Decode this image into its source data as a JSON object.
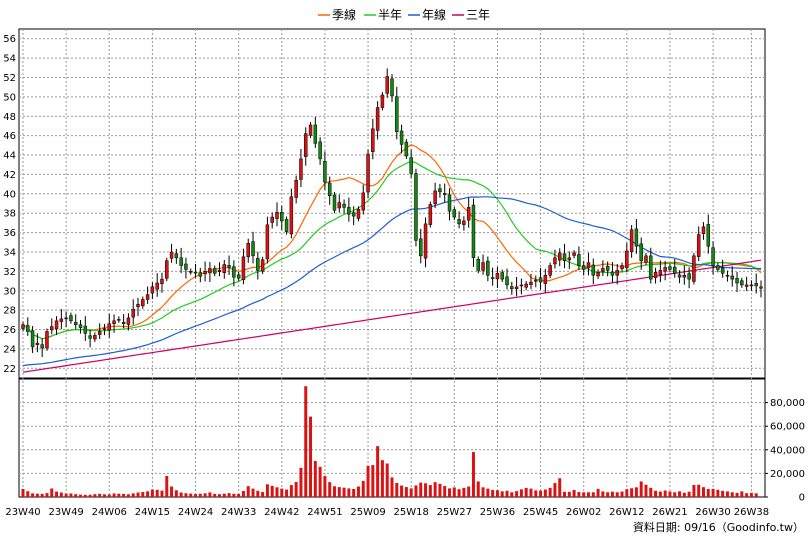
{
  "chart_data": {
    "type": "candlestick",
    "legend": [
      {
        "name": "季線",
        "color": "#ff6600"
      },
      {
        "name": "半年",
        "color": "#22cc22"
      },
      {
        "name": "年線",
        "color": "#1f5fd1"
      },
      {
        "name": "三年",
        "color": "#cc0066"
      }
    ],
    "price_axis": {
      "min": 21,
      "max": 57,
      "ticks": [
        22,
        24,
        26,
        28,
        30,
        32,
        34,
        36,
        38,
        40,
        42,
        44,
        46,
        48,
        50,
        52,
        54,
        56
      ]
    },
    "volume_axis": {
      "min": 0,
      "max": 100000,
      "ticks": [
        0,
        20000,
        40000,
        60000,
        80000
      ],
      "tick_labels": [
        "0",
        "20,000",
        "40,000",
        "60,000",
        "80,000"
      ]
    },
    "x_labels": [
      {
        "label": "23W40",
        "i": 0
      },
      {
        "label": "23W49",
        "i": 9
      },
      {
        "label": "24W06",
        "i": 18
      },
      {
        "label": "24W15",
        "i": 27
      },
      {
        "label": "24W24",
        "i": 36
      },
      {
        "label": "24W33",
        "i": 45
      },
      {
        "label": "24W42",
        "i": 54
      },
      {
        "label": "24W51",
        "i": 63
      },
      {
        "label": "25W09",
        "i": 72
      },
      {
        "label": "25W18",
        "i": 81
      },
      {
        "label": "25W27",
        "i": 90
      },
      {
        "label": "25W36",
        "i": 99
      },
      {
        "label": "25W45",
        "i": 108
      },
      {
        "label": "26W02",
        "i": 117
      },
      {
        "label": "26W12",
        "i": 126
      },
      {
        "label": "26W21",
        "i": 135
      },
      {
        "label": "26W30",
        "i": 144
      },
      {
        "label": "26W38",
        "i": 152
      }
    ],
    "closes": [
      26.5,
      25.8,
      24.2,
      24.6,
      24.1,
      25.8,
      26.3,
      26.9,
      27.1,
      27.2,
      26.9,
      26.5,
      26.2,
      25.6,
      25.1,
      25.4,
      25.8,
      26.1,
      26.6,
      26.9,
      27.0,
      26.6,
      27.2,
      28.1,
      28.6,
      29.1,
      29.6,
      30.4,
      30.8,
      31.2,
      33.1,
      34.0,
      33.4,
      32.6,
      32.2,
      32.0,
      31.8,
      31.5,
      32.0,
      32.3,
      31.8,
      32.1,
      32.7,
      32.4,
      31.4,
      31.3,
      33.5,
      34.9,
      33.6,
      32.1,
      33.2,
      36.8,
      37.6,
      38.1,
      37.2,
      36.1,
      39.7,
      41.4,
      43.6,
      46.2,
      47.1,
      45.2,
      43.6,
      41.2,
      39.8,
      38.3,
      39.1,
      38.6,
      37.9,
      37.7,
      38.4,
      40.1,
      44.1,
      46.7,
      48.9,
      50.2,
      52.1,
      50.1,
      46.4,
      45.1,
      43.9,
      42.1,
      35.2,
      33.6,
      36.9,
      38.9,
      40.3,
      40.2,
      39.9,
      38.2,
      37.6,
      36.9,
      37.2,
      38.6,
      33.4,
      32.1,
      32.9,
      31.6,
      31.3,
      31.8,
      31.2,
      30.6,
      30.2,
      30.4,
      30.6,
      30.7,
      30.9,
      31.1,
      30.9,
      31.6,
      32.6,
      33.4,
      33.9,
      33.1,
      33.4,
      33.9,
      32.6,
      32.2,
      32.9,
      31.6,
      31.9,
      32.3,
      32.1,
      31.6,
      32.1,
      32.6,
      34.1,
      36.3,
      34.6,
      33.1,
      33.6,
      31.2,
      31.9,
      32.1,
      32.4,
      32.2,
      31.8,
      31.4,
      31.6,
      31.2,
      33.6,
      35.8,
      36.6,
      34.6,
      32.6,
      32.2,
      31.8,
      31.6,
      31.2,
      30.8,
      30.6,
      30.6,
      30.6,
      30.5,
      30.4
    ],
    "volumes": [
      6800,
      4900,
      3100,
      2800,
      2600,
      3300,
      7200,
      4600,
      3800,
      2900,
      3000,
      2400,
      2000,
      1800,
      1900,
      2400,
      2700,
      2300,
      2200,
      3000,
      2800,
      2600,
      2300,
      3100,
      3800,
      4200,
      4800,
      6300,
      6100,
      5400,
      17800,
      8900,
      5700,
      3800,
      3200,
      2900,
      2500,
      2800,
      3100,
      3900,
      2600,
      2400,
      2800,
      3300,
      2700,
      2600,
      5100,
      9200,
      7100,
      5300,
      4200,
      10800,
      9500,
      8200,
      7100,
      6300,
      10100,
      12800,
      24700,
      93900,
      68100,
      30500,
      25600,
      17800,
      12600,
      9100,
      8400,
      7900,
      7300,
      6800,
      8900,
      13600,
      26300,
      27100,
      43100,
      31200,
      28400,
      16600,
      11900,
      9700,
      8400,
      7300,
      9800,
      12200,
      11600,
      10100,
      12600,
      11200,
      9300,
      7300,
      8100,
      6600,
      7700,
      8900,
      38100,
      13200,
      8200,
      7100,
      6000,
      5700,
      4800,
      5300,
      4000,
      5000,
      6500,
      7700,
      7100,
      5600,
      5400,
      6400,
      7700,
      11800,
      15900,
      4400,
      4400,
      6000,
      4200,
      4000,
      4000,
      4000,
      6900,
      4700,
      4000,
      4500,
      4000,
      4600,
      6600,
      7400,
      8200,
      13200,
      10400,
      7800,
      5300,
      4600,
      5500,
      4700,
      4000,
      4800,
      3600,
      4500,
      10200,
      10400,
      8300,
      6800,
      6900,
      6100,
      5200,
      4700,
      4000,
      3500,
      4800,
      3200,
      3500,
      3100
    ]
  },
  "footer": {
    "text": "資料日期: 09/16（Goodinfo.tw）"
  }
}
